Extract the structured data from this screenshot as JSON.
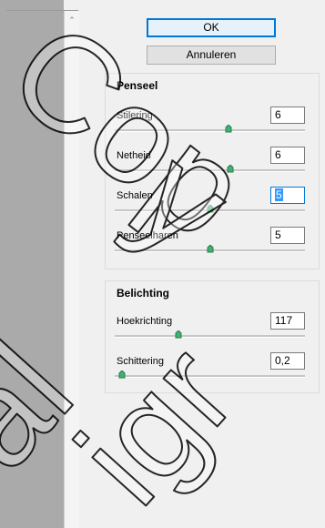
{
  "buttons": {
    "ok": "OK",
    "cancel": "Annuleren"
  },
  "penseel": {
    "title": "Penseel",
    "rows": [
      {
        "label": "Stilering",
        "value": "6",
        "slider_fraction": 0.6
      },
      {
        "label": "Netheid",
        "value": "6",
        "slider_fraction": 0.61
      },
      {
        "label": "Schalen",
        "value": "5",
        "slider_fraction": 0.5,
        "focused": true
      },
      {
        "label": "Penseelharen",
        "value": "5",
        "slider_fraction": 0.5
      }
    ]
  },
  "belichting": {
    "title": "Belichting",
    "rows": [
      {
        "label": "Hoekrichting",
        "value": "117",
        "slider_fraction": 0.33
      },
      {
        "label": "Schittering",
        "value": "0,2",
        "slider_fraction": 0.02
      }
    ]
  },
  "colors": {
    "accent": "#0078d7",
    "thumb": "#3cb371",
    "sidebar": "#aaaaaa",
    "watermark": "#000000"
  },
  "watermark": {
    "text": "Copyright Maligro"
  }
}
